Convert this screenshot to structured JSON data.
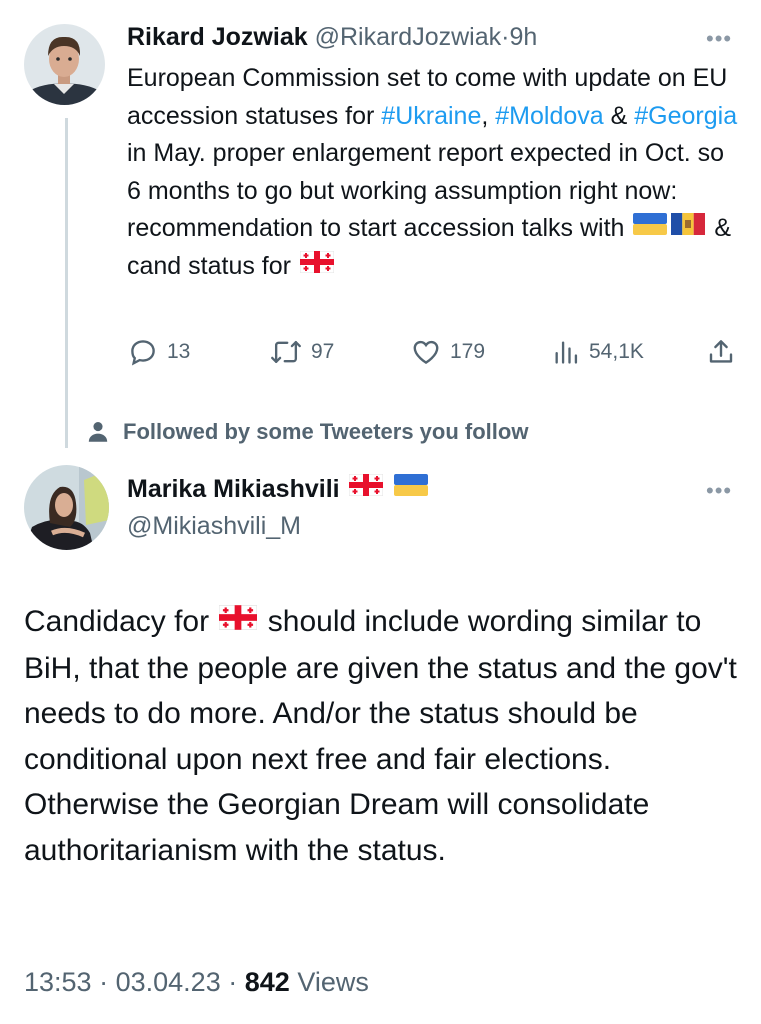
{
  "tweet1": {
    "name": "Rikard Jozwiak",
    "handle": "@RikardJozwiak",
    "dot": "·",
    "time": "9h",
    "more": "•••",
    "text_part1": "European Commission set to come with update on EU accession statuses for",
    "hashtag1": "#Ukraine",
    "sep1": ", ",
    "hashtag2": "#Moldova",
    "sep2": " & ",
    "hashtag3": "#Georgia",
    "text_part2": " in May. proper enlargement report expected in Oct. so 6 months to go but working assumption right now: recommendation to start accession talks with ",
    "text_part3": " & cand status for ",
    "flag_ukraine": "flag-ukraine",
    "flag_moldova": "flag-moldova",
    "flag_georgia": "flag-georgia",
    "replies": "13",
    "retweets": "97",
    "likes": "179",
    "views": "54,1K"
  },
  "followed_by": "Followed by some Tweeters you follow",
  "tweet2": {
    "name": "Marika Mikiashvili",
    "handle": "@Mikiashvili_M",
    "more": "•••",
    "text_part1": "Candidacy for ",
    "text_part2": " should include wording similar to BiH, that the people are given the status and the gov't needs to do more. And/or the status should be conditional upon next free and fair elections. Otherwise the Georgian Dream will consolidate authoritarianism with the status.",
    "time": "13:53",
    "date": "03.04.23",
    "footer_dot": "·",
    "view_count": "842",
    "views_label": "Views"
  },
  "colors": {
    "text": "#0f1419",
    "muted": "#536471",
    "link": "#1d9bf0",
    "thread_line": "#cfd9de"
  }
}
